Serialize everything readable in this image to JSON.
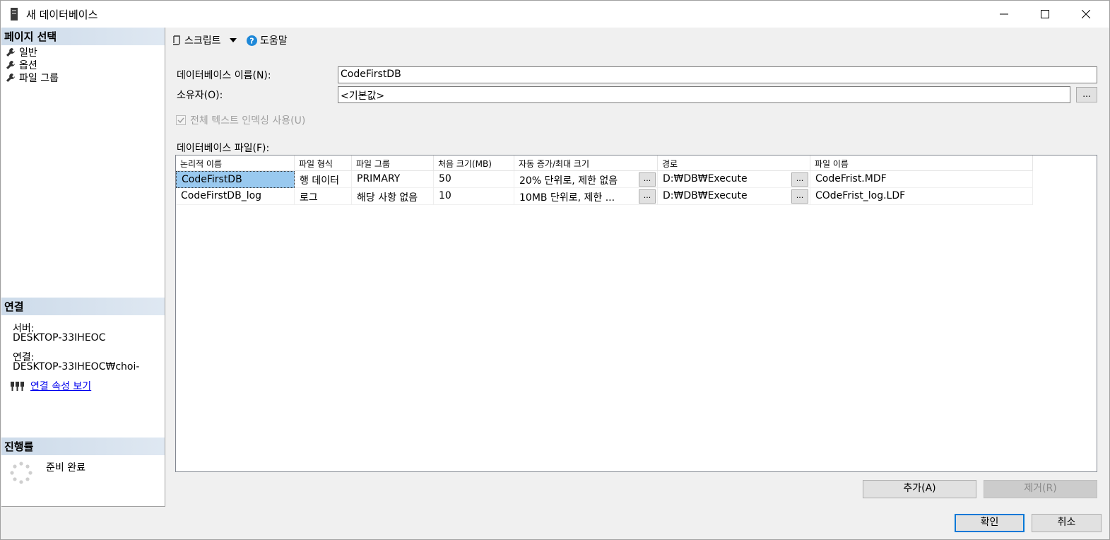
{
  "window": {
    "title": "새 데이터베이스"
  },
  "left": {
    "page_select_header": "페이지 선택",
    "pages": [
      {
        "label": "일반"
      },
      {
        "label": "옵션"
      },
      {
        "label": "파일 그룹"
      }
    ],
    "connection_header": "연결",
    "server_label": "서버:",
    "server_value": "DESKTOP-33IHEOC",
    "connection_label": "연결:",
    "connection_value": "DESKTOP-33IHEOC₩choi-",
    "view_connection_props": "연결 속성 보기",
    "progress_header": "진행률",
    "progress_status": "준비 완료"
  },
  "toolbar": {
    "script_label": "스크립트",
    "help_label": "도움말"
  },
  "form": {
    "db_name_label": "데이터베이스 이름(N):",
    "db_name_value": "CodeFirstDB",
    "owner_label": "소유자(O):",
    "owner_value": "<기본값>",
    "ellipsis": "...",
    "fulltext_label": "전체 텍스트 인덱싱 사용(U)",
    "fulltext_checked": true,
    "db_files_label": "데이터베이스 파일(F):"
  },
  "grid": {
    "headers": [
      "논리적 이름",
      "파일 형식",
      "파일 그룹",
      "처음 크기(MB)",
      "자동 증가/최대 크기",
      "경로",
      "파일 이름"
    ],
    "rows": [
      {
        "logical": "CodeFirstDB",
        "type": "행 데이터",
        "group": "PRIMARY",
        "size": "50",
        "growth": "20% 단위로, 제한 없음",
        "path": "D:₩DB₩Execute",
        "filename": "CodeFrist.MDF"
      },
      {
        "logical": "CodeFirstDB_log",
        "type": "로그",
        "group": "해당 사항 없음",
        "size": "10",
        "growth": "10MB 단위로, 제한 ...",
        "path": "D:₩DB₩Execute",
        "filename": "COdeFrist_log.LDF"
      }
    ]
  },
  "buttons": {
    "add": "추가(A)",
    "remove": "제거(R)",
    "ok": "확인",
    "cancel": "취소"
  }
}
